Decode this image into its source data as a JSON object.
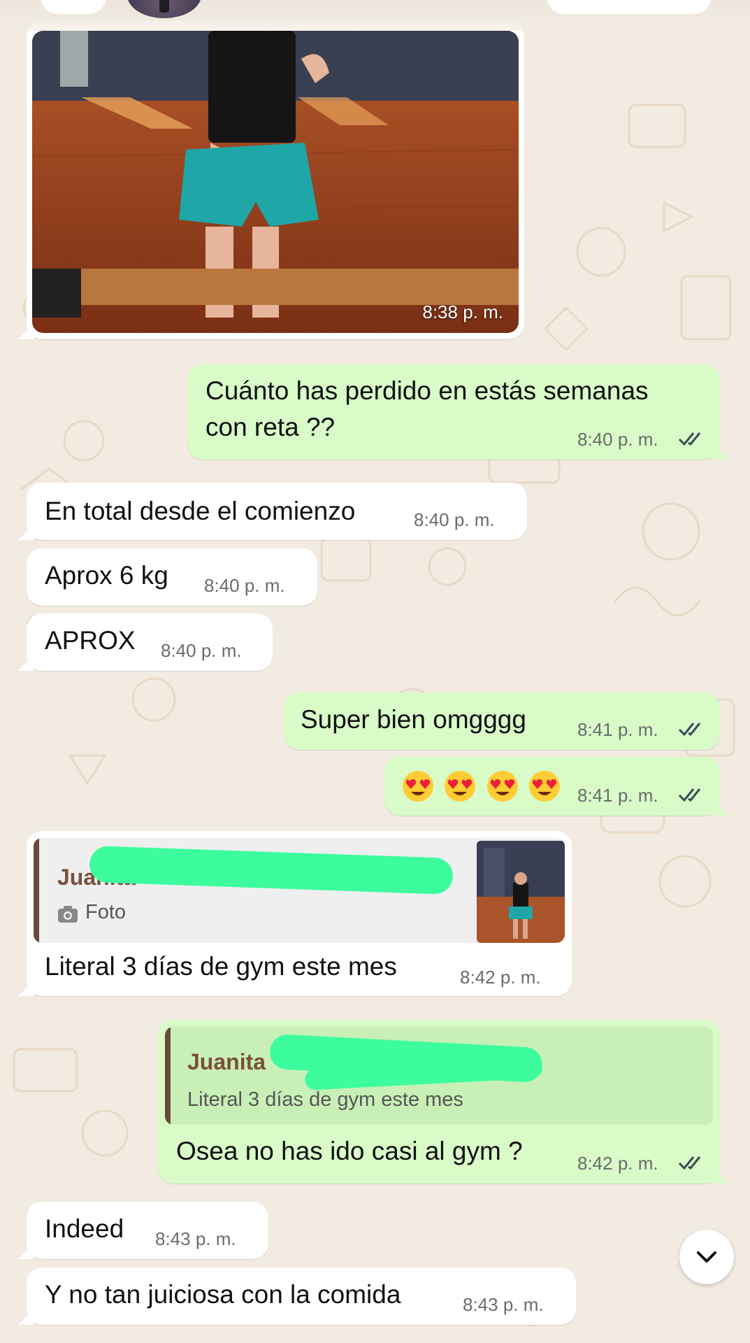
{
  "messages": [
    {
      "time": "8:38 p. m."
    },
    {
      "text_line1": "Cuánto has perdido en estás semanas",
      "text_line2": "con reta ??",
      "time": "8:40 p. m."
    },
    {
      "text": "En total desde el comienzo",
      "time": "8:40 p. m."
    },
    {
      "text": "Aprox 6 kg",
      "time": "8:40 p. m."
    },
    {
      "text": "APROX",
      "time": "8:40 p. m."
    },
    {
      "text": "Super bien omgggg",
      "time": "8:41 p. m."
    },
    {
      "emojis": "😍😍😍😍",
      "time": "8:41 p. m."
    },
    {
      "quote_author": "Juanita",
      "quote_text": "Foto",
      "text": "Literal 3 días de gym este mes",
      "time": "8:42 p. m."
    },
    {
      "quote_author": "Juanita",
      "quote_text": "Literal 3 días de gym este mes",
      "text": "Osea no has ido casi al gym ?",
      "time": "8:42 p. m."
    },
    {
      "text": "Indeed",
      "time": "8:43 p. m."
    },
    {
      "text": "Y no tan juiciosa con la comida",
      "time": "8:43 p. m."
    }
  ],
  "icons": {
    "read_receipt": "double-check-icon",
    "camera": "camera-icon",
    "scroll_down": "chevron-down-icon"
  },
  "colors": {
    "incoming": "#ffffff",
    "outgoing": "#d8fbc8",
    "read_check": "#3b4a55",
    "quote_author": "#7a4f3c",
    "redaction": "#3dfc9e"
  }
}
